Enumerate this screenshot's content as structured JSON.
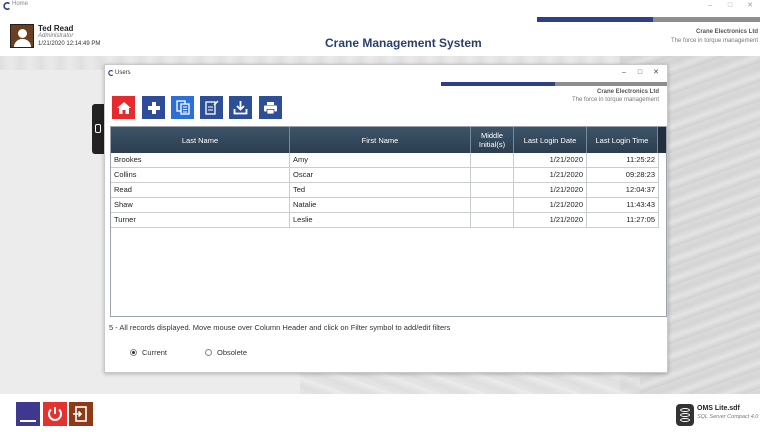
{
  "window": {
    "title": "Home",
    "controls": {
      "minimize": "–",
      "maximize": "□",
      "close": "✕"
    }
  },
  "header": {
    "user_name": "Ted Read",
    "user_role": "Administrator",
    "user_datetime": "1/21/2020 12:14:49 PM",
    "system_title": "Crane Management System",
    "company": "Crane Electronics Ltd",
    "tagline": "The force in torque management"
  },
  "users_window": {
    "title": "Users",
    "controls": {
      "minimize": "–",
      "maximize": "□",
      "close": "✕"
    },
    "company": "Crane Electronics Ltd",
    "tagline": "The force in torque management",
    "toolbar": [
      {
        "name": "home-button",
        "icon": "home-icon",
        "color": "#e62b2f"
      },
      {
        "name": "add-button",
        "icon": "plus-icon",
        "color": "#2f4c9a"
      },
      {
        "name": "copy-button",
        "icon": "copy-icon",
        "color": "#2c6fd6"
      },
      {
        "name": "edit-button",
        "icon": "edit-icon",
        "color": "#2d4f98"
      },
      {
        "name": "export-button",
        "icon": "download-icon",
        "color": "#2d4f98"
      },
      {
        "name": "print-button",
        "icon": "printer-icon",
        "color": "#2d4f98"
      }
    ],
    "grid": {
      "columns": [
        "Last Name",
        "First Name",
        "Middle Initial(s)",
        "Last Login Date",
        "Last Login Time"
      ],
      "rows": [
        {
          "last": "Brookes",
          "first": "Amy",
          "middle": "",
          "date": "1/21/2020",
          "time": "11:25:22"
        },
        {
          "last": "Collins",
          "first": "Oscar",
          "middle": "",
          "date": "1/21/2020",
          "time": "09:28:23"
        },
        {
          "last": "Read",
          "first": "Ted",
          "middle": "",
          "date": "1/21/2020",
          "time": "12:04:37"
        },
        {
          "last": "Shaw",
          "first": "Natalie",
          "middle": "",
          "date": "1/21/2020",
          "time": "11:43:43"
        },
        {
          "last": "Turner",
          "first": "Leslie",
          "middle": "",
          "date": "1/21/2020",
          "time": "11:27:05"
        }
      ]
    },
    "status": "5 - All records displayed. Move mouse over Column Header and click on Filter symbol to add/edit filters",
    "filter": {
      "current_label": "Current",
      "obsolete_label": "Obsolete",
      "selected": "Current"
    }
  },
  "footer": {
    "db_name": "OMS Lite.sdf",
    "db_type": "SQL Server Compact 4.0"
  },
  "colors": {
    "accent_blue": "#2f3f87",
    "title_navy": "#2a3e6c",
    "grid_header": "#2c3e50",
    "danger_red": "#e62b2f"
  }
}
